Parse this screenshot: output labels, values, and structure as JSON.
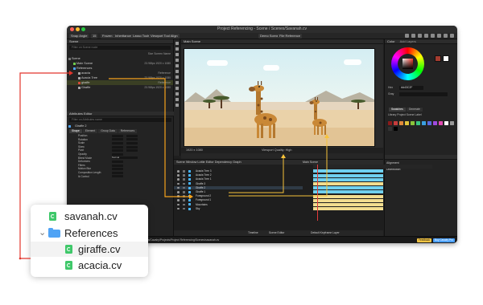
{
  "window": {
    "title": "Project Referencing - Scene / Scenes/Savanah.cv"
  },
  "toolbar": {
    "items": [
      "Snap Angle",
      "15",
      "Frozen",
      "Inheritance",
      "Lasso Tools",
      "Viewport Tool Align"
    ],
    "right_items": [
      "Demo Scenes",
      "File Reference"
    ]
  },
  "scene_panel": {
    "title": "Scene",
    "search_placeholder": "Filter on Scene node",
    "column_right": "Size   Screen   Name",
    "rows": [
      {
        "label": "Scene",
        "meta": "",
        "color": "#7a7a7a"
      },
      {
        "label": "Main Scene",
        "meta": "23.98fps   1920 x 1080",
        "color": "#6fce4d"
      },
      {
        "label": "References",
        "meta": "",
        "color": "#4fa3f5"
      },
      {
        "label": "acacia",
        "meta": "Reference",
        "color": "#aaaaaa"
      },
      {
        "label": "Acacia Tree",
        "meta": "23.98fps   1920 x 1080",
        "color": "#aaaaaa"
      },
      {
        "label": "giraffe",
        "meta": "Reference",
        "color": "#d94a3a"
      },
      {
        "label": "Giraffe",
        "meta": "23.98fps   1920 x 1080",
        "color": "#aaaaaa"
      }
    ]
  },
  "attributes_panel": {
    "title": "Attributes Editor",
    "search_placeholder": "Filter on Attributes name",
    "node_name": "Giraffe 2",
    "tabs": [
      "Shape",
      "Element",
      "Group Data",
      "References"
    ],
    "rows": [
      "Position",
      "Rotation",
      "Scale",
      "Skew",
      "Pivot",
      "Opacity",
      "Blend Mode",
      "Deformers",
      "Filters",
      "Motion Blur",
      "Composition Length",
      "Ik Control"
    ],
    "blend_value": "Normal"
  },
  "viewport": {
    "title": "Main Scene",
    "resolution": "1920 x 1080",
    "preview_label": "Viewport Quality: High"
  },
  "color_panel": {
    "title": "Color",
    "subtitle": "Add Layers",
    "hex_label": "Hex",
    "hex_value": "#A43C2F",
    "gray_label": "Gray",
    "swatches_label": "Swatches",
    "generate_label": "Generate",
    "library_row": "Library   Project   Scene   Label",
    "swatch_colors": [
      "#8b1a1a",
      "#c63c3c",
      "#e08a3a",
      "#e0c43a",
      "#8ac43a",
      "#3ac480",
      "#3aa0e0",
      "#5a6ae0",
      "#a04ae0",
      "#e04ab0",
      "#ffffff",
      "#999999",
      "#333333",
      "#000000"
    ],
    "align_label": "Alignment",
    "distribute_label": "Distribution"
  },
  "timeline": {
    "tabs": "Scene Window   Lottie Editor   Dependency Graph",
    "scene_label": "Main Scene",
    "layers": [
      {
        "name": "Acacia Tree 3",
        "track": "#6fd0ef"
      },
      {
        "name": "Acacia Tree 2",
        "track": "#6fd0ef"
      },
      {
        "name": "Acacia Tree 1",
        "track": "#6fd0ef"
      },
      {
        "name": "Giraffe 3",
        "track": "#f2dd8f"
      },
      {
        "name": "Giraffe 2",
        "track": "#6fd0ef"
      },
      {
        "name": "Giraffe 1",
        "track": "#6fd0ef"
      },
      {
        "name": "Foreground 2",
        "track": "#f2dd8f"
      },
      {
        "name": "Foreground 1",
        "track": "#f2dd8f"
      },
      {
        "name": "Mountains",
        "track": "#f2dd8f"
      },
      {
        "name": "Sky",
        "track": "#f2dd8f"
      }
    ],
    "footer_left": "Timeline",
    "footer_mid": "Scene Editor",
    "footer_right": "Default Keyframe Layer"
  },
  "statusbar": {
    "path": "Scenes/Savanah/LocalizedScene/Documents/Dropbox/AppData/Cavalry/Projects/Project Referencing/Scenes/savanah.cv",
    "badge1": "Feedback",
    "badge2": "Buy Cavalry Pro"
  },
  "finder": {
    "items": [
      {
        "name": "savanah.cv",
        "type": "file"
      },
      {
        "name": "References",
        "type": "folder"
      },
      {
        "name": "giraffe.cv",
        "type": "file"
      },
      {
        "name": "acacia.cv",
        "type": "file"
      }
    ]
  },
  "colors": {
    "accent_red": "#e2352c",
    "accent_orange": "#f5a21c",
    "accent_yellow": "#f7c33a"
  }
}
